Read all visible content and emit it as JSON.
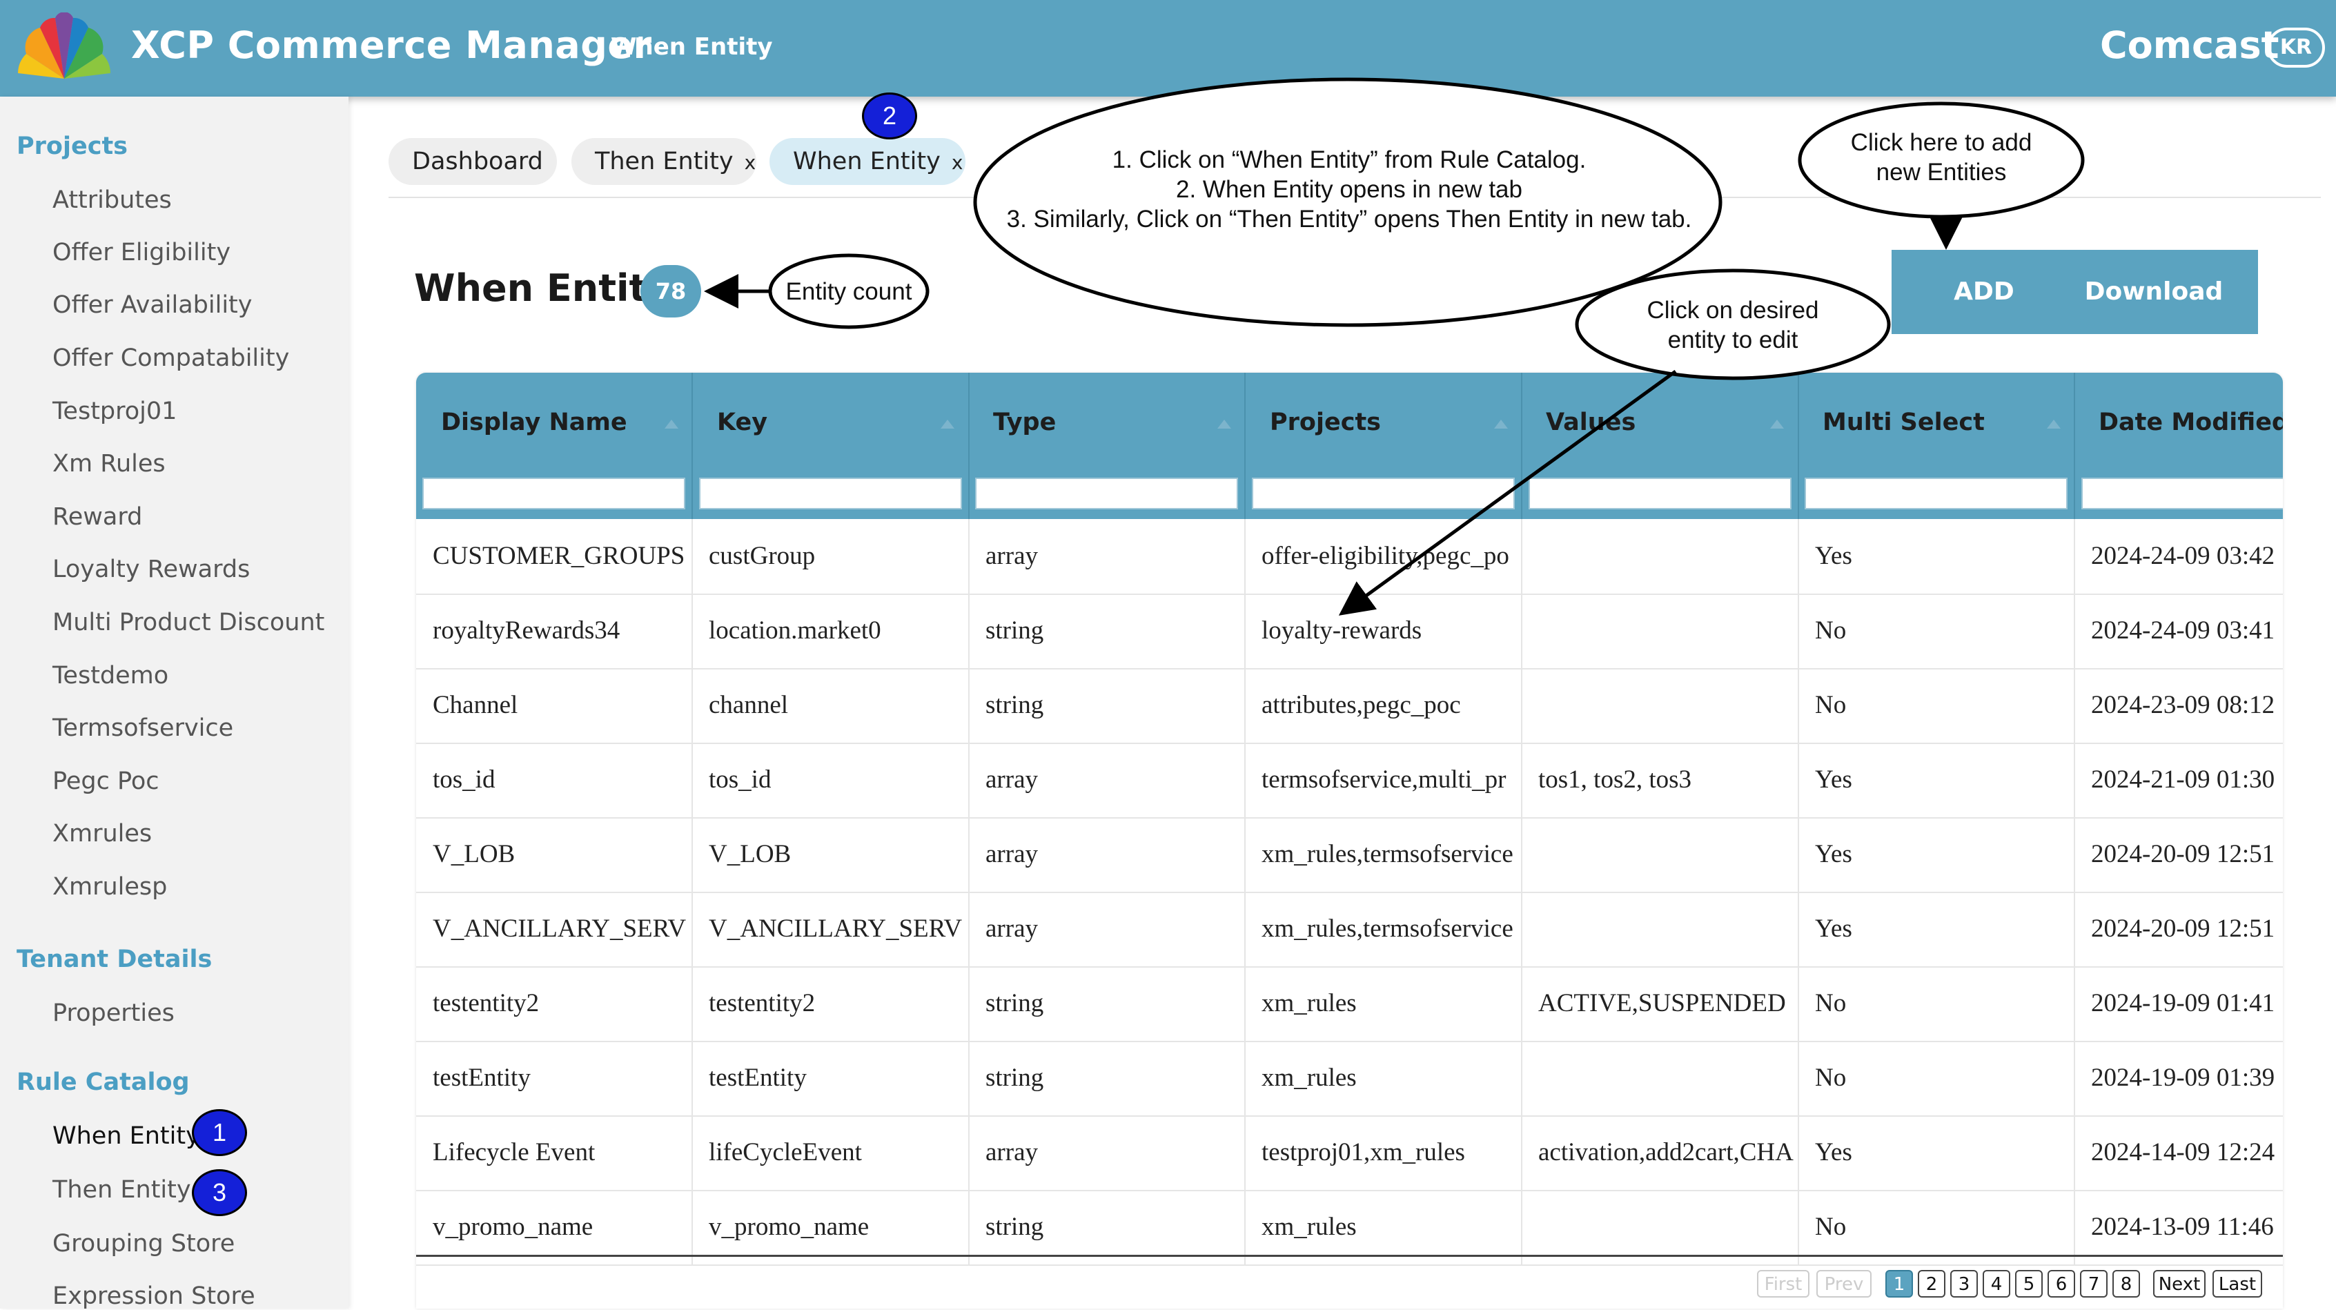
{
  "header": {
    "app_title": "XCP Commerce Manager",
    "subtitle": "When Entity",
    "brand": "Comcast",
    "user_initials": "KR"
  },
  "sidebar": {
    "sections": [
      {
        "title": "Projects",
        "items": [
          "Attributes",
          "Offer Eligibility",
          "Offer Availability",
          "Offer Compatability",
          "Testproj01",
          "Xm Rules",
          "Reward",
          "Loyalty Rewards",
          "Multi Product Discount",
          "Testdemo",
          "Termsofservice",
          "Pegc Poc",
          "Xmrules",
          "Xmrulesp"
        ]
      },
      {
        "title": "Tenant Details",
        "items": [
          "Properties"
        ]
      },
      {
        "title": "Rule Catalog",
        "items": [
          "When Entity",
          "Then Entity",
          "Grouping Store",
          "Expression Store"
        ]
      }
    ],
    "active_item": "When Entity"
  },
  "tabs": [
    {
      "label": "Dashboard",
      "closable": false
    },
    {
      "label": "Then Entity",
      "closable": true
    },
    {
      "label": "When Entity",
      "closable": true,
      "active": true
    }
  ],
  "tab_close_glyph": "x",
  "page": {
    "title": "When Entity",
    "count": "78",
    "add_label": "ADD",
    "download_label": "Download"
  },
  "table": {
    "columns": [
      "Display Name",
      "Key",
      "Type",
      "Projects",
      "Values",
      "Multi Select",
      "Date Modified"
    ],
    "rows": [
      [
        "CUSTOMER_GROUPS",
        "custGroup",
        "array",
        "offer-eligibility,pegc_po",
        "",
        "Yes",
        "2024-24-09 03:42"
      ],
      [
        "royaltyRewards34",
        "location.market0",
        "string",
        "loyalty-rewards",
        "",
        "No",
        "2024-24-09 03:41"
      ],
      [
        "Channel",
        "channel",
        "string",
        "attributes,pegc_poc",
        "",
        "No",
        "2024-23-09 08:12"
      ],
      [
        "tos_id",
        "tos_id",
        "array",
        "termsofservice,multi_pr",
        "tos1, tos2, tos3",
        "Yes",
        "2024-21-09 01:30"
      ],
      [
        "V_LOB",
        "V_LOB",
        "array",
        "xm_rules,termsofservice",
        "",
        "Yes",
        "2024-20-09 12:51"
      ],
      [
        "V_ANCILLARY_SERV",
        "V_ANCILLARY_SERV",
        "array",
        "xm_rules,termsofservice",
        "",
        "Yes",
        "2024-20-09 12:51"
      ],
      [
        "testentity2",
        "testentity2",
        "string",
        "xm_rules",
        "ACTIVE,SUSPENDED",
        "No",
        "2024-19-09 01:41"
      ],
      [
        "testEntity",
        "testEntity",
        "string",
        "xm_rules",
        "",
        "No",
        "2024-19-09 01:39"
      ],
      [
        "Lifecycle Event",
        "lifeCycleEvent",
        "array",
        "testproj01,xm_rules",
        "activation,add2cart,CHA",
        "Yes",
        "2024-14-09 12:24"
      ],
      [
        "v_promo_name",
        "v_promo_name",
        "string",
        "xm_rules",
        "",
        "No",
        "2024-13-09 11:46"
      ]
    ]
  },
  "pagination": {
    "first": "First",
    "prev": "Prev",
    "pages": [
      "1",
      "2",
      "3",
      "4",
      "5",
      "6",
      "7",
      "8"
    ],
    "current": "1",
    "next": "Next",
    "last": "Last"
  },
  "annotations": {
    "steps_lines": [
      "1. Click on “When Entity” from Rule Catalog.",
      "2. When Entity opens in new tab",
      "3. Similarly, Click on “Then Entity” opens Then Entity in new tab."
    ],
    "add_note_lines": [
      "Click here to add",
      "new Entities"
    ],
    "count_note": "Entity count",
    "edit_note_lines": [
      "Click on desired",
      "entity to edit"
    ],
    "badge_1": "1",
    "badge_2": "2",
    "badge_3": "3"
  },
  "colors": {
    "header_bg": "#5ba3c0",
    "accent": "#4b9ec3",
    "badge_blue": "#1420d8",
    "sidebar_bg": "#f2f2f2"
  }
}
